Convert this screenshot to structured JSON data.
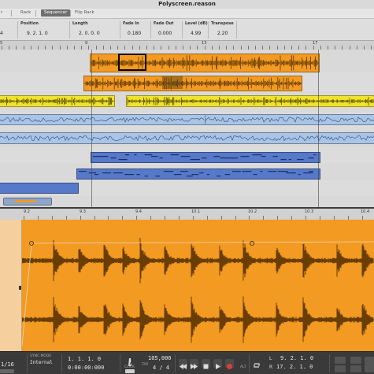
{
  "window": {
    "title": "Polyscreen.reason"
  },
  "tabs": [
    {
      "label": "r"
    },
    {
      "label": "Rack"
    },
    {
      "label": "Sequencer"
    },
    {
      "label": "Flip Rack"
    }
  ],
  "inspector": {
    "fields": [
      {
        "label": "",
        "value": "4"
      },
      {
        "label": "Position",
        "value": "9.  2.  1.  0"
      },
      {
        "label": "Length",
        "value": "2.  0.  0.  0"
      },
      {
        "label": "Fade In",
        "value": "0.180"
      },
      {
        "label": "Fade Out",
        "value": "0.000"
      },
      {
        "label": "Level (dB)",
        "value": "4.99"
      },
      {
        "label": "Transpose",
        "value": "2.20"
      }
    ]
  },
  "ruler": {
    "bars": [
      "5",
      "",
      "9",
      "13",
      "17",
      ""
    ]
  },
  "editor_ruler": {
    "marks": [
      "9.2",
      "9.3",
      "9.4",
      "10.1",
      "10.2",
      "10.3",
      "10.4"
    ]
  },
  "transport": {
    "quantize_label": "",
    "quantize_value": "1/16",
    "sync_mode_label": "SYNC MODE",
    "sync_mode_value": "Internal",
    "position_bars": "1.  1.  1.  0",
    "position_time": "0:00:00:000",
    "click_label": "CLICK",
    "tempo_tap_label": "TAP",
    "tempo_value": "105,000",
    "signature_value": "4 / 4",
    "alt_label": "ALT",
    "loop_left_label": "L",
    "loop_right_label": "R",
    "loop_left_value": "9.  2.  1.  0",
    "loop_right_value": "17.  2.  1.  0"
  },
  "colors": {
    "orange_clip": "#f39a22",
    "yellow_clip": "#f1e22d",
    "blue_clip": "#5679c9",
    "record_button": "#e23b3b"
  }
}
